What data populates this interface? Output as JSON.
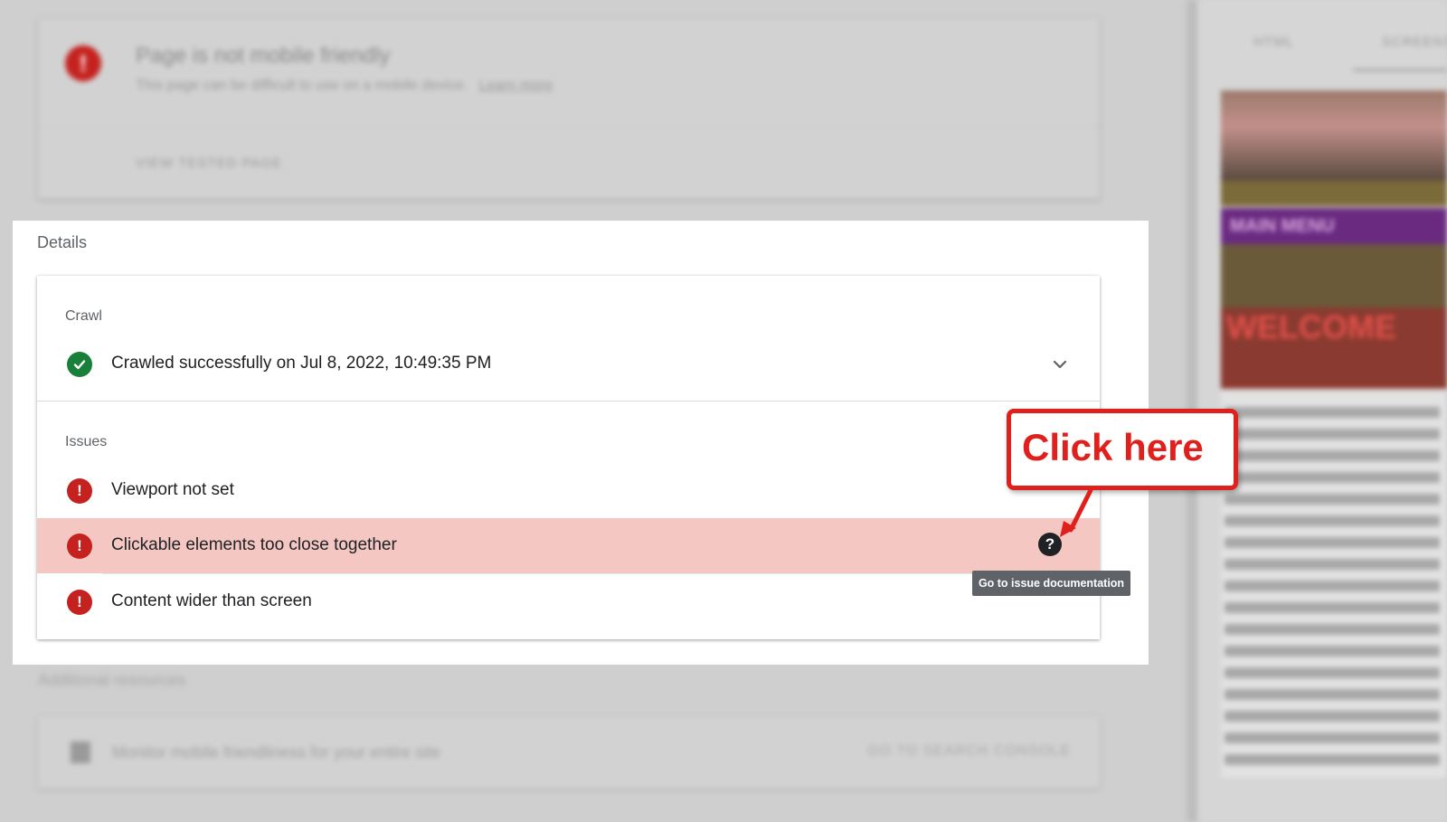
{
  "background": {
    "result_title": "Page is not mobile friendly",
    "result_subtitle": "This page can be difficult to use on a mobile device.",
    "learn_more": "Learn more",
    "view_tested_page": "VIEW TESTED PAGE",
    "additional_resources_title": "Additional resources",
    "monitor_text": "Monitor mobile friendliness for your entire site",
    "search_console_button": "GO TO SEARCH CONSOLE",
    "side_tabs": [
      "HTML",
      "SCREENSHOT"
    ],
    "preview_menu_text": "MAIN MENU",
    "preview_welcome_text": "WELCOME"
  },
  "details": {
    "title": "Details",
    "crawl": {
      "label": "Crawl",
      "status_text": "Crawled successfully on Jul 8, 2022, 10:49:35 PM",
      "status_icon": "check-circle-icon"
    },
    "issues": {
      "label": "Issues",
      "items": [
        {
          "text": "Viewport not set",
          "icon": "error-icon",
          "highlighted": false
        },
        {
          "text": "Clickable elements too close together",
          "icon": "error-icon",
          "highlighted": true
        },
        {
          "text": "Content wider than screen",
          "icon": "error-icon",
          "highlighted": false
        }
      ]
    },
    "tooltip": "Go to issue documentation"
  },
  "annotation": {
    "callout_text": "Click here",
    "color": "#e0201c"
  },
  "colors": {
    "success": "#188038",
    "error": "#c5221f",
    "highlight_row": "#f4c7c3",
    "tooltip_bg": "#5f6368"
  }
}
